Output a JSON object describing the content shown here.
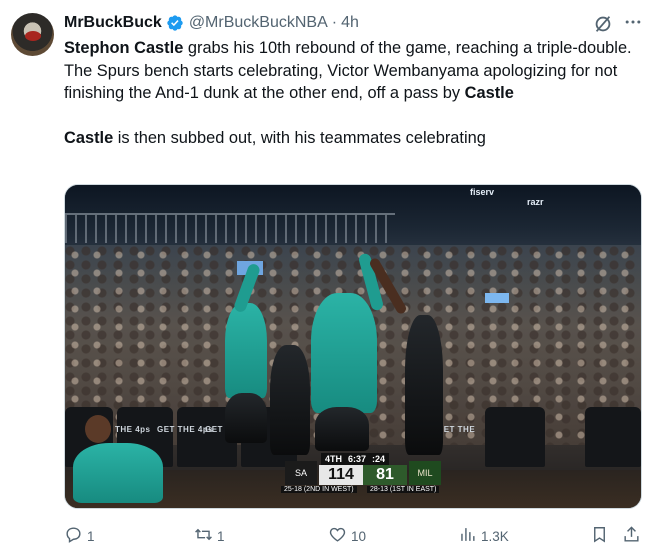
{
  "author": {
    "name": "MrBuckBuck",
    "handle": "@MrBuckBuckNBA",
    "separator": "·",
    "time": "4h",
    "verified_icon": "verified-badge-icon",
    "avatar_icon": "avatar"
  },
  "post": {
    "line1_bold": "Stephon Castle",
    "line1_rest": " grabs his 10th rebound of the game, reaching a triple-double.",
    "line2_part1": "The Spurs bench starts celebrating, Victor Wembanyama apologizing for not finishing the And-1 dunk at the other end, off a pass by ",
    "line2_bold": "Castle",
    "line3_bold": "Castle",
    "line3_rest": " is then subbed out, with his teammates celebrating"
  },
  "media": {
    "seat_texts": [
      "THE 4ps",
      "GET THE 4ps",
      "GET THE",
      "GET THE"
    ],
    "seat_text_right": "GET THE",
    "arena_signs": [
      "fiserv",
      "razr"
    ],
    "scorebug": {
      "quarter": "4TH",
      "clock": "6:37",
      "shot_clock": ":24",
      "home_score": "114",
      "away_score": "81",
      "home_record": "25-18 (2ND IN WEST)",
      "away_record": "28-13 (1ST IN EAST)"
    }
  },
  "actions": {
    "reply_count": "1",
    "repost_count": "1",
    "like_count": "10",
    "view_count": "1.3K"
  },
  "icons": {
    "grok": "grok-icon",
    "more": "more-icon",
    "reply": "reply-icon",
    "repost": "repost-icon",
    "like": "like-icon",
    "views": "views-icon",
    "bookmark": "bookmark-icon",
    "share": "share-icon"
  },
  "colors": {
    "text": "#0f1419",
    "secondary": "#536471",
    "verified": "#1d9bf0",
    "spurs_teal": "#2bb3a6",
    "bucks_green": "#2e5a2b"
  }
}
